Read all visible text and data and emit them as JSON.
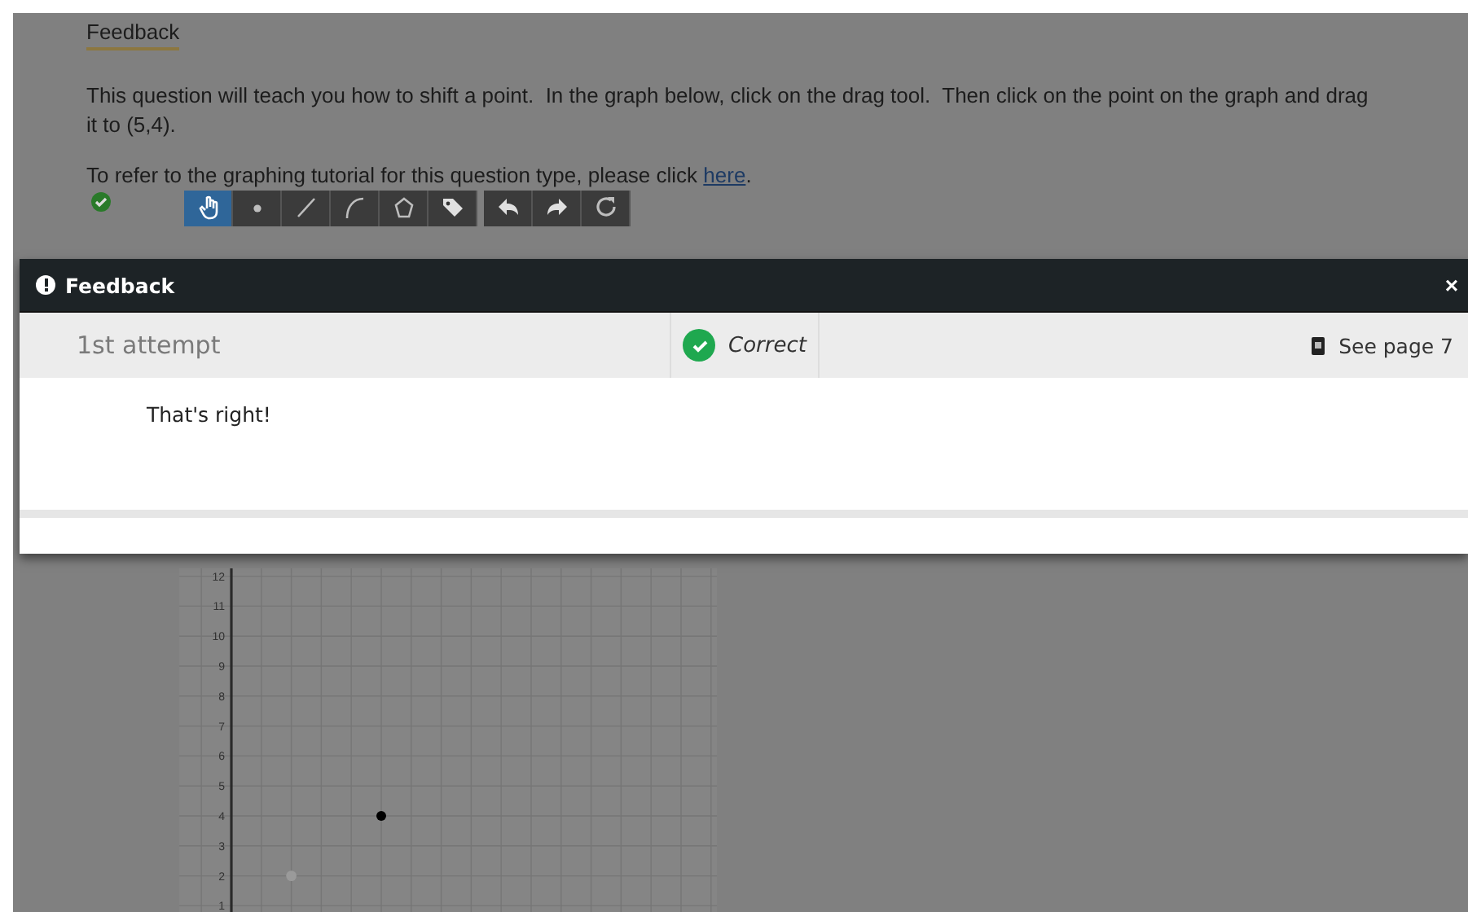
{
  "page": {
    "heading": "Feedback",
    "question": "This question will teach you how to shift a point.  In the graph below, click on the drag tool.  Then click on the point on the graph and drag it to (5,4).",
    "tutorial": {
      "before": "To refer to the graphing tutorial for this question type, please click ",
      "link": "here",
      "after": "."
    },
    "answer_correct": true
  },
  "toolbar": [
    {
      "kind": "drag",
      "selected": true
    },
    {
      "kind": "point",
      "selected": false
    },
    {
      "kind": "line",
      "selected": false
    },
    {
      "kind": "curve",
      "selected": false
    },
    {
      "kind": "polygon",
      "selected": false
    },
    {
      "kind": "label",
      "selected": false
    },
    {
      "kind": "undo",
      "selected": false
    },
    {
      "kind": "redo",
      "selected": false
    },
    {
      "kind": "reset",
      "selected": false
    }
  ],
  "graph": {
    "y_labels": [
      "12",
      "11",
      "10",
      "9",
      "8",
      "7",
      "6",
      "5",
      "4",
      "3",
      "2",
      "1"
    ]
  },
  "modal": {
    "title": "Feedback",
    "close": "×",
    "attempt": "1st attempt",
    "result": {
      "text": "Correct",
      "correct": true
    },
    "reference": "See page 7",
    "message": "That's right!"
  }
}
